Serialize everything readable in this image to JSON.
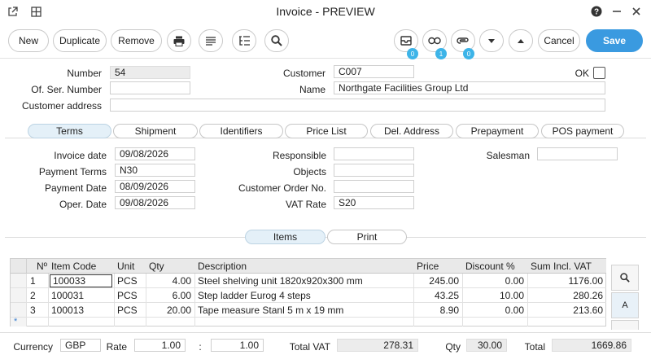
{
  "window": {
    "title": "Invoice - PREVIEW"
  },
  "toolbar": {
    "new_label": "New",
    "duplicate_label": "Duplicate",
    "remove_label": "Remove",
    "cancel_label": "Cancel",
    "save_label": "Save",
    "badges": {
      "attachments": "0",
      "links": "1",
      "clips": "0"
    }
  },
  "header": {
    "number_label": "Number",
    "number_value": "54",
    "of_ser_number_label": "Of. Ser. Number",
    "of_ser_number_value": "",
    "customer_address_label": "Customer address",
    "customer_address_value": "",
    "customer_label": "Customer",
    "customer_value": "C007",
    "name_label": "Name",
    "name_value": "Northgate Facilities Group Ltd",
    "ok_label": "OK"
  },
  "tabs": [
    "Terms",
    "Shipment",
    "Identifiers",
    "Price List",
    "Del. Address",
    "Prepayment",
    "POS payment"
  ],
  "terms": {
    "invoice_date_label": "Invoice date",
    "invoice_date_value": "09/08/2026",
    "payment_terms_label": "Payment Terms",
    "payment_terms_value": "N30",
    "payment_date_label": "Payment Date",
    "payment_date_value": "08/09/2026",
    "oper_date_label": "Oper. Date",
    "oper_date_value": "09/08/2026",
    "responsible_label": "Responsible",
    "responsible_value": "",
    "objects_label": "Objects",
    "objects_value": "",
    "customer_order_label": "Customer Order No.",
    "customer_order_value": "",
    "vat_rate_label": "VAT Rate",
    "vat_rate_value": "S20",
    "salesman_label": "Salesman",
    "salesman_value": ""
  },
  "subtabs": [
    "Items",
    "Print"
  ],
  "items": {
    "columns": [
      "Nº",
      "Item Code",
      "Unit",
      "Qty",
      "Description",
      "Price",
      "Discount %",
      "Sum Incl. VAT"
    ],
    "rows": [
      [
        "1",
        "100033",
        "PCS",
        "4.00",
        "Steel shelving unit 1820x920x300 mm",
        "245.00",
        "0.00",
        "1176.00"
      ],
      [
        "2",
        "100031",
        "PCS",
        "6.00",
        "Step ladder Eurog 4 steps",
        "43.25",
        "10.00",
        "280.26"
      ],
      [
        "3",
        "100013",
        "PCS",
        "20.00",
        "Tape measure Stanl 5 m x 19 mm",
        "8.90",
        "0.00",
        "213.60"
      ]
    ],
    "new_row_marker": "*",
    "side_letter": "A"
  },
  "footer": {
    "currency_label": "Currency",
    "currency_value": "GBP",
    "rate_label": "Rate",
    "rate_value": "1.00",
    "rate_sep": ":",
    "rate_value2": "1.00",
    "total_vat_label": "Total VAT",
    "total_vat_value": "278.31",
    "qty_label": "Qty",
    "qty_value": "30.00",
    "total_label": "Total",
    "total_value": "1669.86"
  },
  "colors": {
    "accent": "#3a9ae0",
    "badge": "#3db4e8",
    "active_tab": "#e4f0f8"
  }
}
